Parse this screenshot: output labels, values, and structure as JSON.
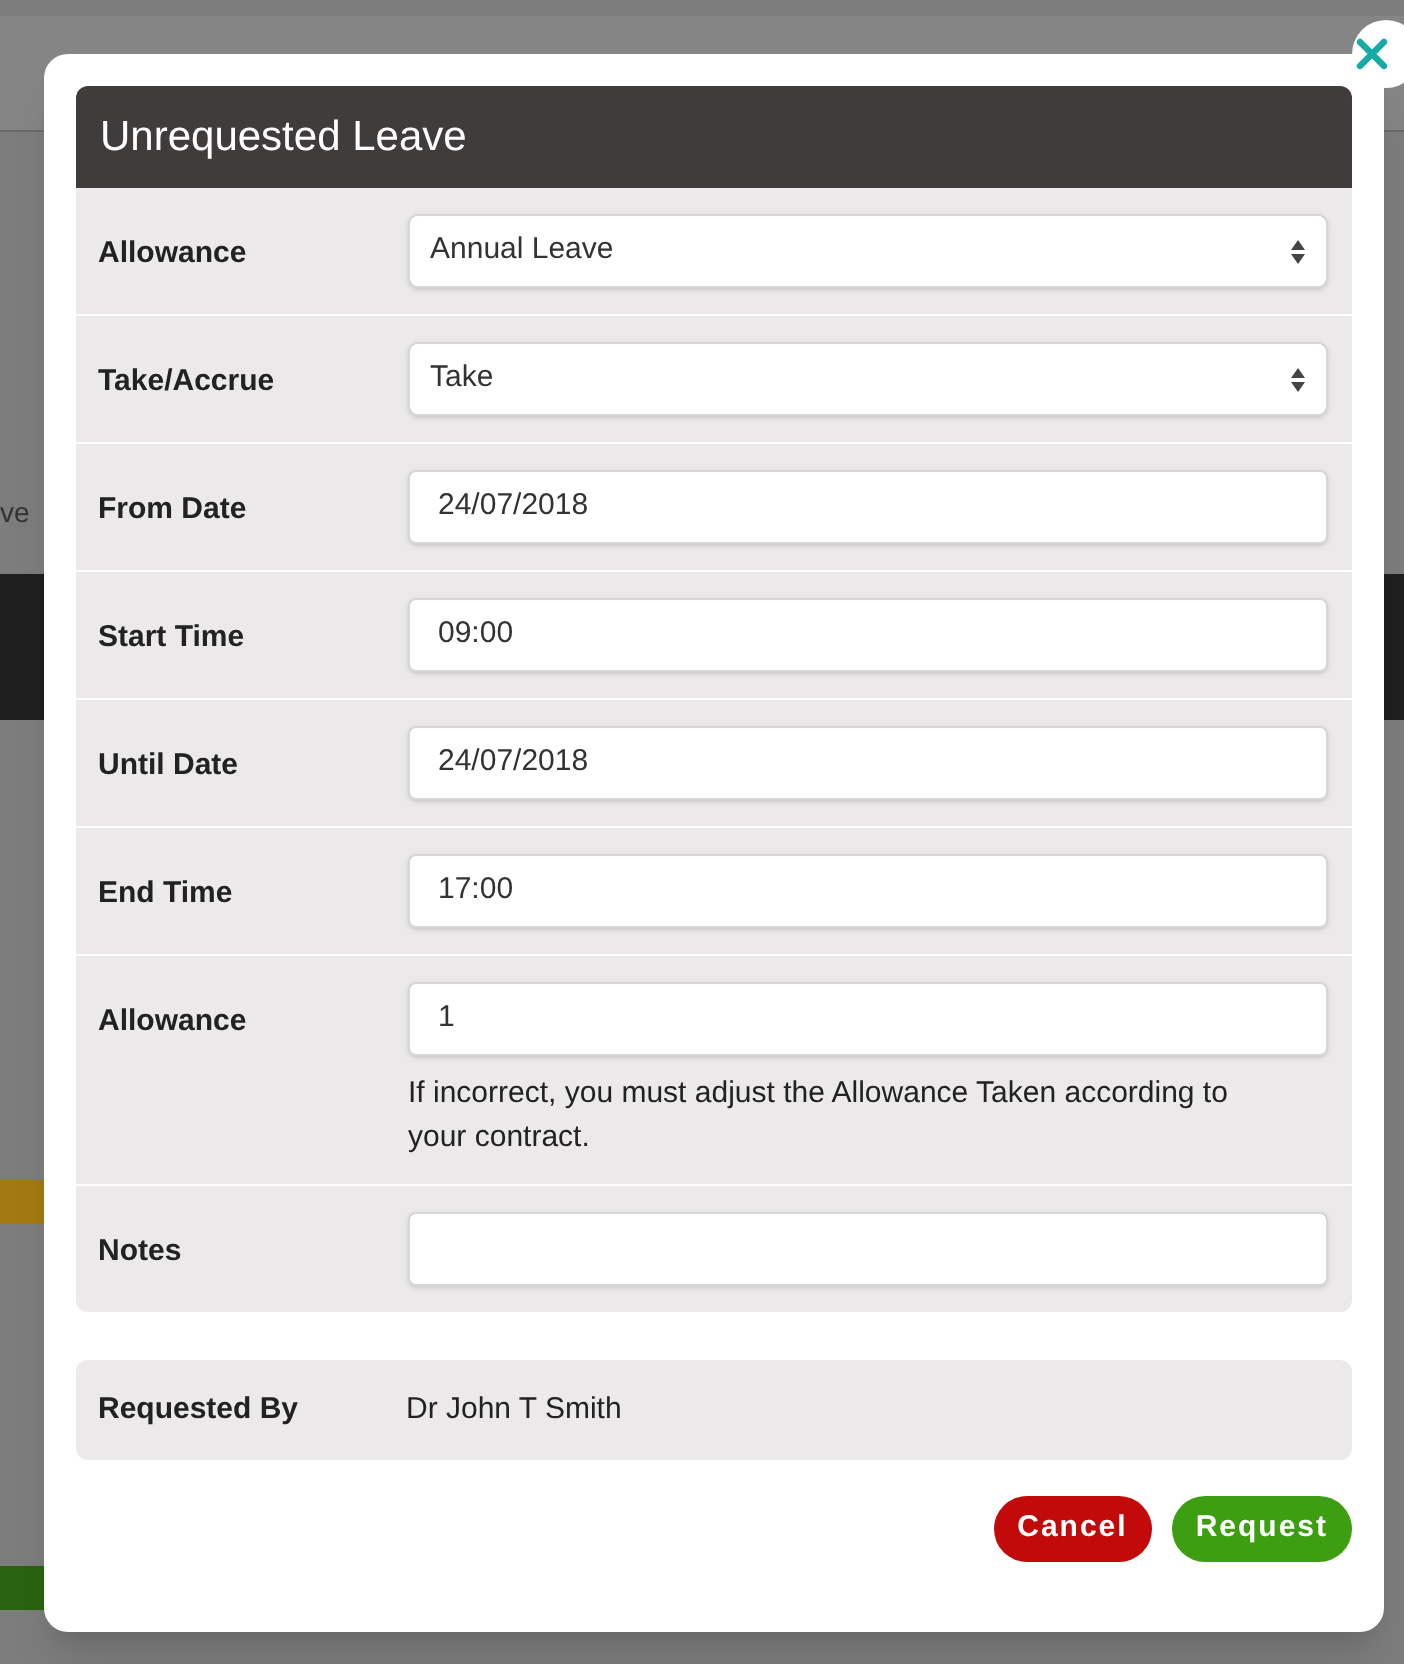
{
  "background": {
    "fragment": "ve"
  },
  "dialog": {
    "title": "Unrequested Leave",
    "fields": [
      {
        "kind": "select",
        "label": "Allowance",
        "value": "Annual Leave"
      },
      {
        "kind": "select",
        "label": "Take/Accrue",
        "value": "Take"
      },
      {
        "kind": "input",
        "label": "From Date",
        "value": "24/07/2018"
      },
      {
        "kind": "input",
        "label": "Start Time",
        "value": "09:00"
      },
      {
        "kind": "input",
        "label": "Until Date",
        "value": "24/07/2018"
      },
      {
        "kind": "input",
        "label": "End Time",
        "value": "17:00"
      },
      {
        "kind": "input",
        "label": "Allowance",
        "value": "1",
        "help": "If incorrect, you must adjust the Allowance Taken according to your contract."
      },
      {
        "kind": "input",
        "label": "Notes"
      }
    ],
    "requested_by": {
      "label": "Requested By",
      "value": "Dr John T Smith"
    },
    "buttons": [
      {
        "kind": "cancel",
        "label": "Cancel"
      },
      {
        "kind": "primary",
        "label": "Request"
      }
    ]
  }
}
